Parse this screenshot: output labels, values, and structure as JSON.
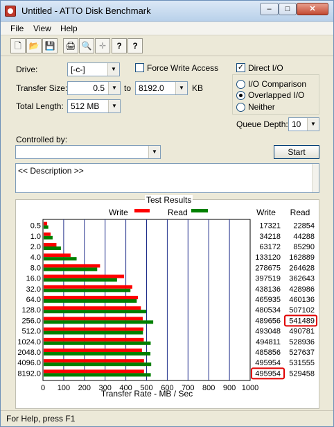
{
  "window": {
    "title": "Untitled - ATTO Disk Benchmark",
    "controls": {
      "minimize": "–",
      "maximize": "□",
      "close": "✕"
    }
  },
  "menu": {
    "items": [
      "File",
      "View",
      "Help"
    ]
  },
  "toolbar": {
    "icons": [
      "new-file-icon",
      "open-folder-icon",
      "save-icon",
      "print-icon",
      "print-preview-icon",
      "move-icon",
      "help-icon",
      "context-help-icon"
    ],
    "glyphs": [
      "🗋",
      "📂",
      "💾",
      "🖨",
      "🔍",
      "✛",
      "?",
      "?"
    ]
  },
  "form": {
    "drive_label": "Drive:",
    "drive_value": "[-c-]",
    "transfer_label": "Transfer Size:",
    "transfer_from": "0.5",
    "to_label": "to",
    "transfer_to": "8192.0",
    "kb_label": "KB",
    "total_label": "Total Length:",
    "total_value": "512 MB",
    "force_write_label": "Force Write Access",
    "force_write_checked": false,
    "direct_io_label": "Direct I/O",
    "direct_io_checked": true,
    "io_comparison_label": "I/O Comparison",
    "overlapped_label": "Overlapped I/O",
    "neither_label": "Neither",
    "selected_io_mode": "Overlapped I/O",
    "queue_label": "Queue Depth:",
    "queue_value": "10",
    "controlled_label": "Controlled by:",
    "controlled_value": "",
    "start_label": "Start",
    "description": "<< Description >>",
    "check_glyph": "✓"
  },
  "results": {
    "title": "Test Results",
    "legend_write": "Write",
    "legend_read": "Read",
    "col_write": "Write",
    "col_read": "Read"
  },
  "chart_data": {
    "type": "bar",
    "orientation": "horizontal",
    "categories": [
      "0.5",
      "1.0",
      "2.0",
      "4.0",
      "8.0",
      "16.0",
      "32.0",
      "64.0",
      "128.0",
      "256.0",
      "512.0",
      "1024.0",
      "2048.0",
      "4096.0",
      "8192.0"
    ],
    "series": [
      {
        "name": "Write",
        "color": "#ff0000",
        "values": [
          17321,
          34218,
          63172,
          133120,
          278675,
          397519,
          438136,
          465935,
          480534,
          489656,
          493048,
          494811,
          485856,
          495954,
          495954
        ]
      },
      {
        "name": "Read",
        "color": "#008000",
        "values": [
          22854,
          44288,
          85290,
          162889,
          264628,
          362643,
          428986,
          460136,
          507102,
          541489,
          490781,
          528936,
          527637,
          531555,
          529458
        ]
      }
    ],
    "xlabel": "Transfer Rate - MB / Sec",
    "xlim": [
      0,
      1000
    ],
    "xticks": [
      "0",
      "100",
      "200",
      "300",
      "400",
      "500",
      "600",
      "700",
      "800",
      "900",
      "1000"
    ],
    "highlighted_values": [
      "541489",
      "495954"
    ],
    "highlight_color": "#e00000"
  },
  "status": {
    "text": "For Help, press F1"
  }
}
